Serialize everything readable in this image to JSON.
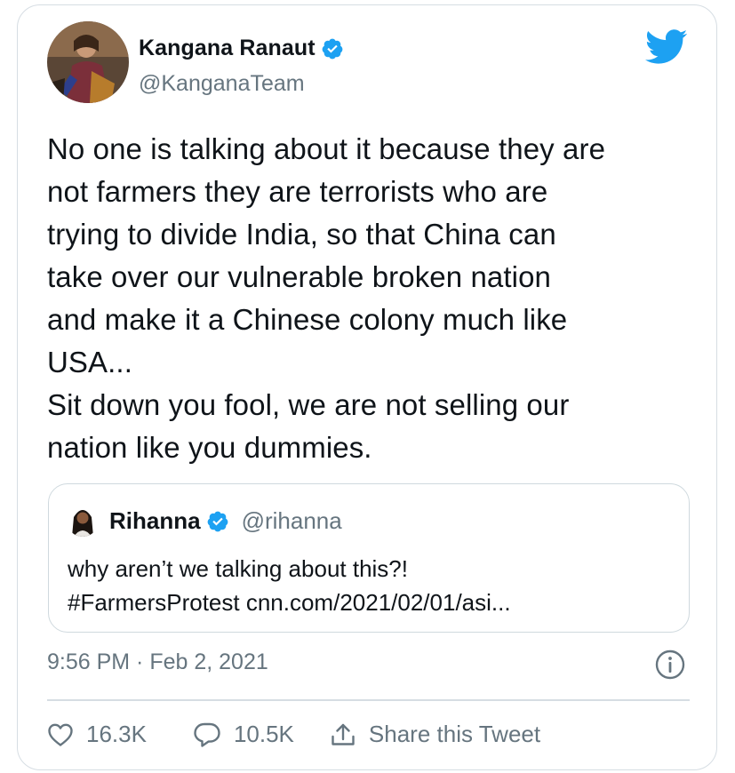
{
  "tweet": {
    "author_name": "Kangana Ranaut",
    "author_handle": "@KanganaTeam",
    "text": "No one is talking about it because they are\nnot farmers they are terrorists who are\ntrying to divide India, so that China can\ntake over our vulnerable broken nation\nand make it a Chinese colony much like\nUSA...\nSit down you fool, we are not selling our\nnation like you dummies.",
    "timestamp": "9:56 PM · Feb 2, 2021"
  },
  "quoted_tweet": {
    "author_name": "Rihanna",
    "author_handle": "@rihanna",
    "text": "why aren’t we talking about this?!\n#FarmersProtest cnn.com/2021/02/01/asi..."
  },
  "actions": {
    "like_count": "16.3K",
    "reply_count": "10.5K",
    "share_label": "Share this Tweet"
  },
  "icons": {
    "brand": "twitter-bird-icon",
    "verified": "verified-badge-icon",
    "info": "info-icon",
    "like": "heart-icon",
    "reply": "speech-bubble-icon",
    "share": "share-upload-icon"
  },
  "colors": {
    "brand_blue": "#1DA1F2",
    "secondary_text": "#66757f",
    "primary_text": "#0f1419",
    "border": "#d6dde3"
  }
}
